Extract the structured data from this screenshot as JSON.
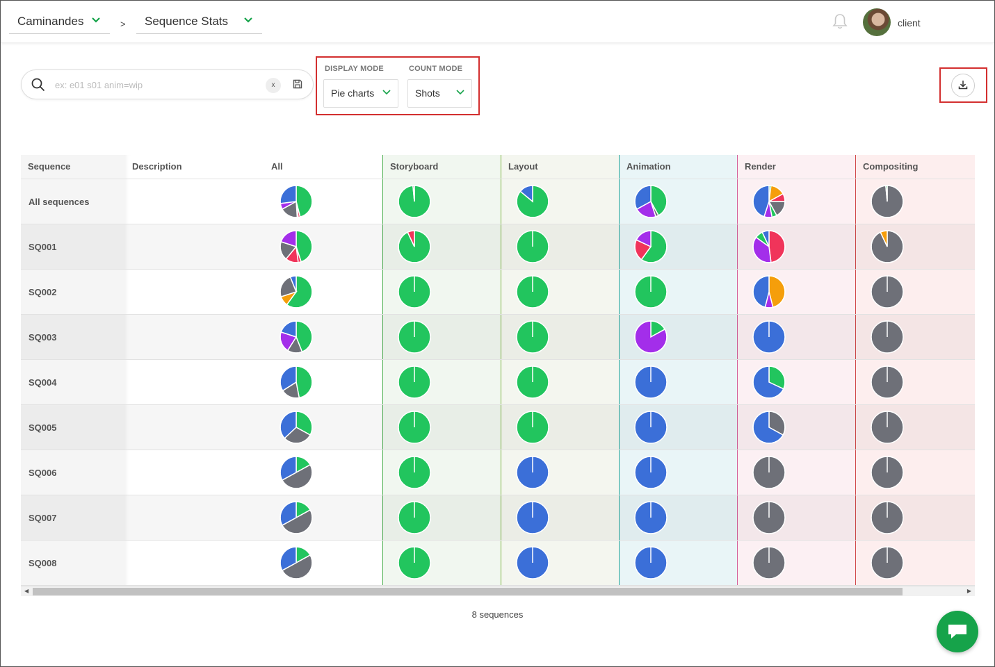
{
  "header": {
    "production": "Caminandes",
    "separator": ">",
    "page": "Sequence Stats",
    "user": "client"
  },
  "search": {
    "placeholder": "ex: e01 s01 anim=wip",
    "value": "",
    "clear_label": "x"
  },
  "display_mode": {
    "label": "DISPLAY MODE",
    "value": "Pie charts"
  },
  "count_mode": {
    "label": "COUNT MODE",
    "value": "Shots"
  },
  "colors": {
    "done": "#22c55e",
    "wip": "#3b6fd8",
    "todo": "#6e7078",
    "retake": "#f0345a",
    "wfa": "#a32eea",
    "orange": "#f59e0b"
  },
  "table": {
    "headers": {
      "sequence": "Sequence",
      "description": "Description",
      "all": "All",
      "storyboard": "Storyboard",
      "layout": "Layout",
      "animation": "Animation",
      "render": "Render",
      "compositing": "Compositing"
    },
    "rows": [
      {
        "name": "All sequences",
        "pies": {
          "all": [
            [
              "done",
              0.46
            ],
            [
              "retake",
              0.02
            ],
            [
              "wfa",
              0.01
            ],
            [
              "todo",
              0.18
            ],
            [
              "wfa",
              0.06
            ],
            [
              "wip",
              0.27
            ]
          ],
          "storyboard": [
            [
              "done",
              0.985
            ],
            [
              "todo",
              0.015
            ]
          ],
          "layout": [
            [
              "done",
              0.86
            ],
            [
              "wip",
              0.14
            ]
          ],
          "animation": [
            [
              "done",
              0.42
            ],
            [
              "todo",
              0.03
            ],
            [
              "wfa",
              0.22
            ],
            [
              "wip",
              0.33
            ]
          ],
          "render": [
            [
              "done",
              0.02
            ],
            [
              "orange",
              0.15
            ],
            [
              "retake",
              0.08
            ],
            [
              "todo",
              0.17
            ],
            [
              "done",
              0.05
            ],
            [
              "wfa",
              0.08
            ],
            [
              "wip",
              0.45
            ]
          ],
          "compositing": [
            [
              "todo",
              0.985
            ],
            [
              "done",
              0.015
            ]
          ]
        }
      },
      {
        "name": "SQ001",
        "pies": {
          "all": [
            [
              "done",
              0.45
            ],
            [
              "retake",
              0.03
            ],
            [
              "retake",
              0.13
            ],
            [
              "todo",
              0.19
            ],
            [
              "wfa",
              0.2
            ]
          ],
          "storyboard": [
            [
              "done",
              0.93
            ],
            [
              "retake",
              0.07
            ]
          ],
          "layout": [
            [
              "done",
              1
            ]
          ],
          "animation": [
            [
              "done",
              0.6
            ],
            [
              "retake",
              0.22
            ],
            [
              "wfa",
              0.18
            ]
          ],
          "render": [
            [
              "retake",
              0.48
            ],
            [
              "wfa",
              0.37
            ],
            [
              "done",
              0.08
            ],
            [
              "wip",
              0.07
            ]
          ],
          "compositing": [
            [
              "todo",
              0.93
            ],
            [
              "orange",
              0.07
            ]
          ]
        }
      },
      {
        "name": "SQ002",
        "pies": {
          "all": [
            [
              "done",
              0.6
            ],
            [
              "orange",
              0.1
            ],
            [
              "todo",
              0.24
            ],
            [
              "wip",
              0.06
            ]
          ],
          "storyboard": [
            [
              "done",
              1
            ]
          ],
          "layout": [
            [
              "done",
              1
            ]
          ],
          "animation": [
            [
              "done",
              1
            ]
          ],
          "render": [
            [
              "orange",
              0.46
            ],
            [
              "wfa",
              0.08
            ],
            [
              "wip",
              0.46
            ]
          ],
          "compositing": [
            [
              "todo",
              1
            ]
          ]
        }
      },
      {
        "name": "SQ003",
        "pies": {
          "all": [
            [
              "done",
              0.44
            ],
            [
              "todo",
              0.15
            ],
            [
              "wfa",
              0.21
            ],
            [
              "wip",
              0.2
            ]
          ],
          "storyboard": [
            [
              "done",
              1
            ]
          ],
          "layout": [
            [
              "done",
              1
            ]
          ],
          "animation": [
            [
              "done",
              0.17
            ],
            [
              "wfa",
              0.83
            ]
          ],
          "render": [
            [
              "wip",
              1
            ]
          ],
          "compositing": [
            [
              "todo",
              1
            ]
          ]
        }
      },
      {
        "name": "SQ004",
        "pies": {
          "all": [
            [
              "done",
              0.47
            ],
            [
              "todo",
              0.19
            ],
            [
              "wip",
              0.34
            ]
          ],
          "storyboard": [
            [
              "done",
              1
            ]
          ],
          "layout": [
            [
              "done",
              1
            ]
          ],
          "animation": [
            [
              "wip",
              1
            ]
          ],
          "render": [
            [
              "done",
              0.32
            ],
            [
              "wip",
              0.68
            ]
          ],
          "compositing": [
            [
              "todo",
              1
            ]
          ]
        }
      },
      {
        "name": "SQ005",
        "pies": {
          "all": [
            [
              "done",
              0.33
            ],
            [
              "todo",
              0.3
            ],
            [
              "wip",
              0.37
            ]
          ],
          "storyboard": [
            [
              "done",
              1
            ]
          ],
          "layout": [
            [
              "done",
              1
            ]
          ],
          "animation": [
            [
              "wip",
              1
            ]
          ],
          "render": [
            [
              "todo",
              0.33
            ],
            [
              "wip",
              0.67
            ]
          ],
          "compositing": [
            [
              "todo",
              1
            ]
          ]
        }
      },
      {
        "name": "SQ006",
        "pies": {
          "all": [
            [
              "done",
              0.17
            ],
            [
              "todo",
              0.5
            ],
            [
              "wip",
              0.33
            ]
          ],
          "storyboard": [
            [
              "done",
              1
            ]
          ],
          "layout": [
            [
              "wip",
              1
            ]
          ],
          "animation": [
            [
              "wip",
              1
            ]
          ],
          "render": [
            [
              "todo",
              1
            ]
          ],
          "compositing": [
            [
              "todo",
              1
            ]
          ]
        }
      },
      {
        "name": "SQ007",
        "pies": {
          "all": [
            [
              "done",
              0.17
            ],
            [
              "todo",
              0.5
            ],
            [
              "wip",
              0.33
            ]
          ],
          "storyboard": [
            [
              "done",
              1
            ]
          ],
          "layout": [
            [
              "wip",
              1
            ]
          ],
          "animation": [
            [
              "wip",
              1
            ]
          ],
          "render": [
            [
              "todo",
              1
            ]
          ],
          "compositing": [
            [
              "todo",
              1
            ]
          ]
        }
      },
      {
        "name": "SQ008",
        "pies": {
          "all": [
            [
              "done",
              0.17
            ],
            [
              "todo",
              0.5
            ],
            [
              "wip",
              0.33
            ]
          ],
          "storyboard": [
            [
              "done",
              1
            ]
          ],
          "layout": [
            [
              "wip",
              1
            ]
          ],
          "animation": [
            [
              "wip",
              1
            ]
          ],
          "render": [
            [
              "todo",
              1
            ]
          ],
          "compositing": [
            [
              "todo",
              1
            ]
          ]
        }
      }
    ]
  },
  "footer": {
    "count": "8 sequences"
  }
}
